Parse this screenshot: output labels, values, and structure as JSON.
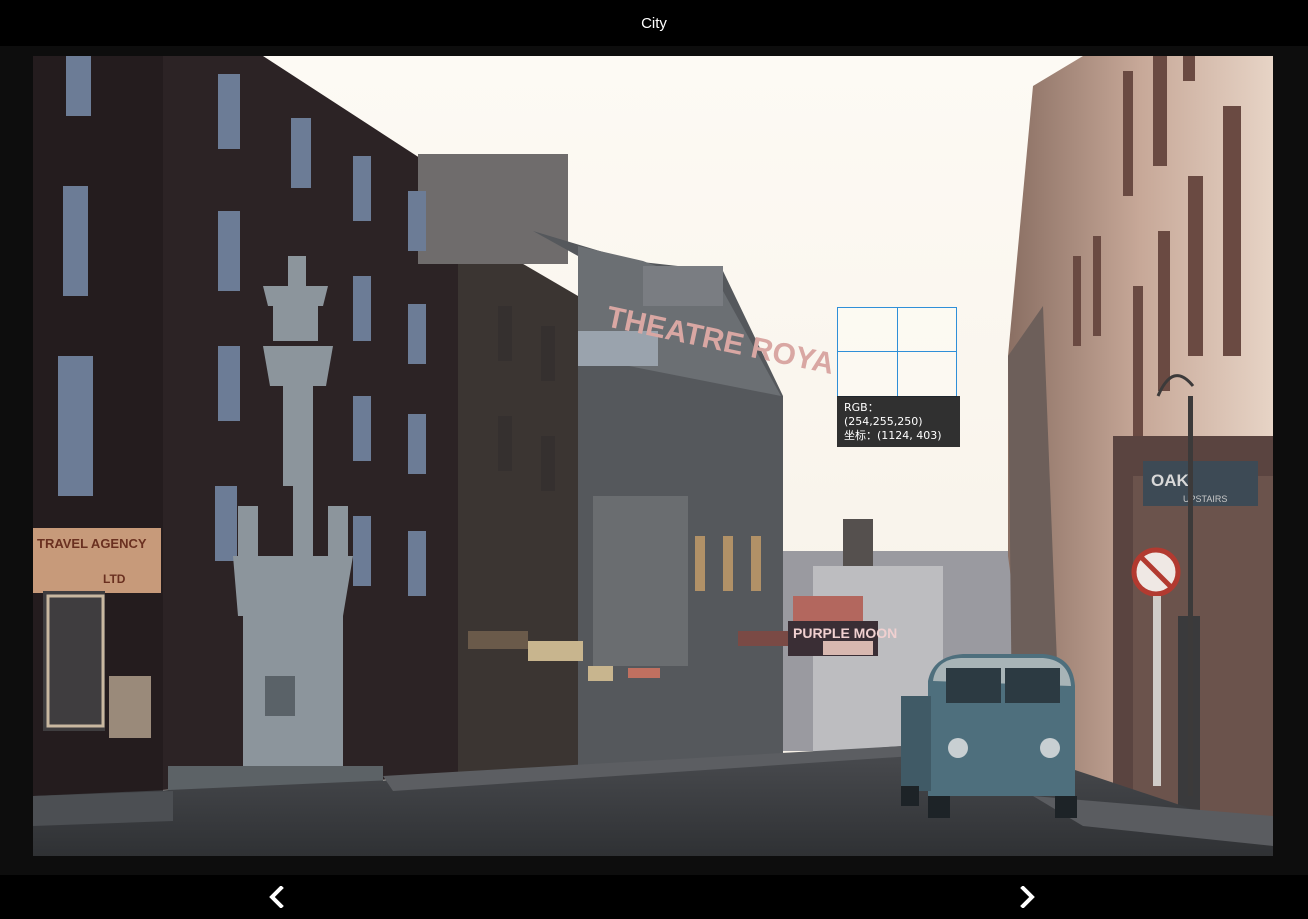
{
  "window": {
    "title": "City"
  },
  "photo": {
    "signs": {
      "theatre_sign": "THEATRE ROYA",
      "travel_agency_line1": "TRAVEL AGENCY",
      "travel_agency_line2": "LTD",
      "purple_moon": "PURPLE MOON",
      "oak_sign": "OAK",
      "upstairs_sign": "UPSTAIRS"
    }
  },
  "pixel_inspector": {
    "rgb_label": "RGB：",
    "rgb_value": "(254,255,250)",
    "coord_label": "坐标：",
    "coord_value": "(1124, 403)",
    "accent_color": "#2f8fd8"
  },
  "navigation": {
    "prev_icon": "chevron-left-icon",
    "next_icon": "chevron-right-icon"
  }
}
